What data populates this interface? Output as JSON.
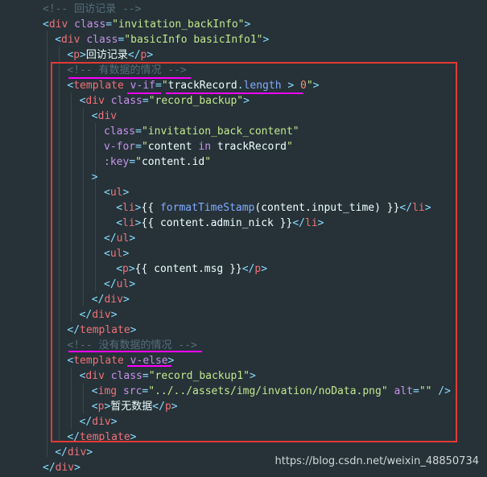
{
  "code_lines": [
    {
      "indent": 4,
      "segments": [
        {
          "t": "com",
          "v": "<!-- 回访记录 -->"
        }
      ]
    },
    {
      "indent": 4,
      "segments": [
        {
          "t": "punc",
          "v": "<"
        },
        {
          "t": "tag",
          "v": "div"
        },
        {
          "t": "txt",
          "v": " "
        },
        {
          "t": "attr",
          "v": "class"
        },
        {
          "t": "punc",
          "v": "="
        },
        {
          "t": "str",
          "v": "\"invitation_backInfo\""
        },
        {
          "t": "punc",
          "v": ">"
        }
      ]
    },
    {
      "indent": 6,
      "segments": [
        {
          "t": "punc",
          "v": "<"
        },
        {
          "t": "tag",
          "v": "div"
        },
        {
          "t": "txt",
          "v": " "
        },
        {
          "t": "attr",
          "v": "class"
        },
        {
          "t": "punc",
          "v": "="
        },
        {
          "t": "str",
          "v": "\"basicInfo basicInfo1\""
        },
        {
          "t": "punc",
          "v": ">"
        }
      ]
    },
    {
      "indent": 8,
      "segments": [
        {
          "t": "punc",
          "v": "<"
        },
        {
          "t": "tag",
          "v": "p"
        },
        {
          "t": "punc",
          "v": ">"
        },
        {
          "t": "txt",
          "v": "回访记录"
        },
        {
          "t": "punc",
          "v": "</"
        },
        {
          "t": "tag",
          "v": "p"
        },
        {
          "t": "punc",
          "v": ">"
        }
      ]
    },
    {
      "indent": 8,
      "segments": [
        {
          "t": "com",
          "v": "<!-- 有数据的情况 -->"
        }
      ]
    },
    {
      "indent": 8,
      "segments": [
        {
          "t": "punc",
          "v": "<"
        },
        {
          "t": "tag",
          "v": "template"
        },
        {
          "t": "txt",
          "v": " "
        },
        {
          "t": "attr",
          "v": "v-if"
        },
        {
          "t": "punc",
          "v": "="
        },
        {
          "t": "str",
          "v": "\""
        },
        {
          "t": "txt",
          "v": "trackRecord"
        },
        {
          "t": "punc",
          "v": "."
        },
        {
          "t": "fn",
          "v": "length"
        },
        {
          "t": "txt",
          "v": " "
        },
        {
          "t": "op",
          "v": ">"
        },
        {
          "t": "txt",
          "v": " "
        },
        {
          "t": "num",
          "v": "0"
        },
        {
          "t": "str",
          "v": "\""
        },
        {
          "t": "punc",
          "v": ">"
        }
      ]
    },
    {
      "indent": 10,
      "segments": [
        {
          "t": "punc",
          "v": "<"
        },
        {
          "t": "tag",
          "v": "div"
        },
        {
          "t": "txt",
          "v": " "
        },
        {
          "t": "attr",
          "v": "class"
        },
        {
          "t": "punc",
          "v": "="
        },
        {
          "t": "str",
          "v": "\"record_backup\""
        },
        {
          "t": "punc",
          "v": ">"
        }
      ]
    },
    {
      "indent": 12,
      "segments": [
        {
          "t": "punc",
          "v": "<"
        },
        {
          "t": "tag",
          "v": "div"
        }
      ]
    },
    {
      "indent": 14,
      "segments": [
        {
          "t": "attr",
          "v": "class"
        },
        {
          "t": "punc",
          "v": "="
        },
        {
          "t": "str",
          "v": "\"invitation_back_content\""
        }
      ]
    },
    {
      "indent": 14,
      "segments": [
        {
          "t": "attr",
          "v": "v-for"
        },
        {
          "t": "punc",
          "v": "="
        },
        {
          "t": "str",
          "v": "\""
        },
        {
          "t": "txt",
          "v": "content "
        },
        {
          "t": "kw",
          "v": "in"
        },
        {
          "t": "txt",
          "v": " trackRecord"
        },
        {
          "t": "str",
          "v": "\""
        }
      ]
    },
    {
      "indent": 14,
      "segments": [
        {
          "t": "attr",
          "v": ":key"
        },
        {
          "t": "punc",
          "v": "="
        },
        {
          "t": "str",
          "v": "\""
        },
        {
          "t": "txt",
          "v": "content.id"
        },
        {
          "t": "str",
          "v": "\""
        }
      ]
    },
    {
      "indent": 12,
      "segments": [
        {
          "t": "punc",
          "v": ">"
        }
      ]
    },
    {
      "indent": 14,
      "segments": [
        {
          "t": "punc",
          "v": "<"
        },
        {
          "t": "tag",
          "v": "ul"
        },
        {
          "t": "punc",
          "v": ">"
        }
      ]
    },
    {
      "indent": 16,
      "segments": [
        {
          "t": "punc",
          "v": "<"
        },
        {
          "t": "tag",
          "v": "li"
        },
        {
          "t": "punc",
          "v": ">"
        },
        {
          "t": "txt",
          "v": "{{ "
        },
        {
          "t": "fn",
          "v": "formatTimeStamp"
        },
        {
          "t": "txt",
          "v": "(content.input_time) }}"
        },
        {
          "t": "punc",
          "v": "</"
        },
        {
          "t": "tag",
          "v": "li"
        },
        {
          "t": "punc",
          "v": ">"
        }
      ]
    },
    {
      "indent": 16,
      "segments": [
        {
          "t": "punc",
          "v": "<"
        },
        {
          "t": "tag",
          "v": "li"
        },
        {
          "t": "punc",
          "v": ">"
        },
        {
          "t": "txt",
          "v": "{{ content.admin_nick }}"
        },
        {
          "t": "punc",
          "v": "</"
        },
        {
          "t": "tag",
          "v": "li"
        },
        {
          "t": "punc",
          "v": ">"
        }
      ]
    },
    {
      "indent": 14,
      "segments": [
        {
          "t": "punc",
          "v": "</"
        },
        {
          "t": "tag",
          "v": "ul"
        },
        {
          "t": "punc",
          "v": ">"
        }
      ]
    },
    {
      "indent": 14,
      "segments": [
        {
          "t": "punc",
          "v": "<"
        },
        {
          "t": "tag",
          "v": "ul"
        },
        {
          "t": "punc",
          "v": ">"
        }
      ]
    },
    {
      "indent": 16,
      "segments": [
        {
          "t": "punc",
          "v": "<"
        },
        {
          "t": "tag",
          "v": "p"
        },
        {
          "t": "punc",
          "v": ">"
        },
        {
          "t": "txt",
          "v": "{{ content.msg }}"
        },
        {
          "t": "punc",
          "v": "</"
        },
        {
          "t": "tag",
          "v": "p"
        },
        {
          "t": "punc",
          "v": ">"
        }
      ]
    },
    {
      "indent": 14,
      "segments": [
        {
          "t": "punc",
          "v": "</"
        },
        {
          "t": "tag",
          "v": "ul"
        },
        {
          "t": "punc",
          "v": ">"
        }
      ]
    },
    {
      "indent": 12,
      "segments": [
        {
          "t": "punc",
          "v": "</"
        },
        {
          "t": "tag",
          "v": "div"
        },
        {
          "t": "punc",
          "v": ">"
        }
      ]
    },
    {
      "indent": 10,
      "segments": [
        {
          "t": "punc",
          "v": "</"
        },
        {
          "t": "tag",
          "v": "div"
        },
        {
          "t": "punc",
          "v": ">"
        }
      ]
    },
    {
      "indent": 8,
      "segments": [
        {
          "t": "punc",
          "v": "</"
        },
        {
          "t": "tag",
          "v": "template"
        },
        {
          "t": "punc",
          "v": ">"
        }
      ]
    },
    {
      "indent": 8,
      "segments": [
        {
          "t": "com",
          "v": "<!-- 没有数据的情况 -->"
        }
      ]
    },
    {
      "indent": 8,
      "segments": [
        {
          "t": "punc",
          "v": "<"
        },
        {
          "t": "tag",
          "v": "template"
        },
        {
          "t": "txt",
          "v": " "
        },
        {
          "t": "attr",
          "v": "v-else"
        },
        {
          "t": "punc",
          "v": ">"
        }
      ]
    },
    {
      "indent": 10,
      "segments": [
        {
          "t": "punc",
          "v": "<"
        },
        {
          "t": "tag",
          "v": "div"
        },
        {
          "t": "txt",
          "v": " "
        },
        {
          "t": "attr",
          "v": "class"
        },
        {
          "t": "punc",
          "v": "="
        },
        {
          "t": "str",
          "v": "\"record_backup1\""
        },
        {
          "t": "punc",
          "v": ">"
        }
      ]
    },
    {
      "indent": 12,
      "segments": [
        {
          "t": "punc",
          "v": "<"
        },
        {
          "t": "tag",
          "v": "img"
        },
        {
          "t": "txt",
          "v": " "
        },
        {
          "t": "attr",
          "v": "src"
        },
        {
          "t": "punc",
          "v": "="
        },
        {
          "t": "str",
          "v": "\"../../assets/img/invation/noData.png\""
        },
        {
          "t": "txt",
          "v": " "
        },
        {
          "t": "attr",
          "v": "alt"
        },
        {
          "t": "punc",
          "v": "="
        },
        {
          "t": "str",
          "v": "\"\""
        },
        {
          "t": "txt",
          "v": " "
        },
        {
          "t": "punc",
          "v": "/>"
        }
      ]
    },
    {
      "indent": 12,
      "segments": [
        {
          "t": "punc",
          "v": "<"
        },
        {
          "t": "tag",
          "v": "p"
        },
        {
          "t": "punc",
          "v": ">"
        },
        {
          "t": "txt",
          "v": "暂无数据"
        },
        {
          "t": "punc",
          "v": "</"
        },
        {
          "t": "tag",
          "v": "p"
        },
        {
          "t": "punc",
          "v": ">"
        }
      ]
    },
    {
      "indent": 10,
      "segments": [
        {
          "t": "punc",
          "v": "</"
        },
        {
          "t": "tag",
          "v": "div"
        },
        {
          "t": "punc",
          "v": ">"
        }
      ]
    },
    {
      "indent": 8,
      "segments": [
        {
          "t": "punc",
          "v": "</"
        },
        {
          "t": "tag",
          "v": "template"
        },
        {
          "t": "punc",
          "v": ">"
        }
      ]
    },
    {
      "indent": 6,
      "segments": [
        {
          "t": "punc",
          "v": "</"
        },
        {
          "t": "tag",
          "v": "div"
        },
        {
          "t": "punc",
          "v": ">"
        }
      ]
    },
    {
      "indent": 4,
      "segments": [
        {
          "t": "punc",
          "v": "</"
        },
        {
          "t": "tag",
          "v": "div"
        },
        {
          "t": "punc",
          "v": ">"
        }
      ]
    }
  ],
  "watermark": "https://blog.csdn.net/weixin_48850734",
  "colors": {
    "background": "#263238",
    "highlight_box": "#e53935",
    "underline": "#ff00ff"
  }
}
